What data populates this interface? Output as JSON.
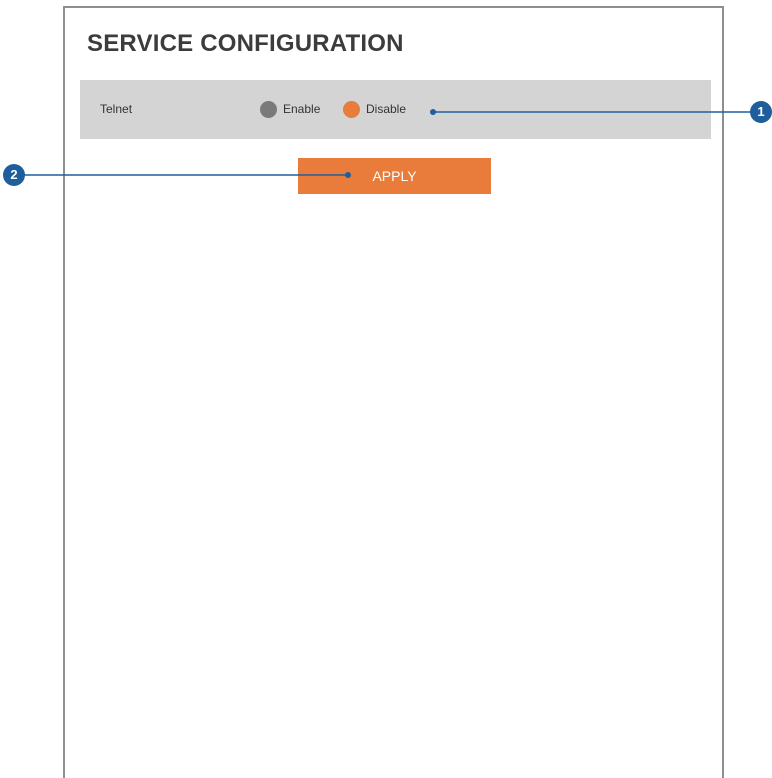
{
  "page": {
    "title": "SERVICE CONFIGURATION"
  },
  "telnet": {
    "label": "Telnet",
    "options": [
      {
        "label": "Enable",
        "selected": false
      },
      {
        "label": "Disable",
        "selected": true
      }
    ],
    "colors": {
      "unselected": "#7a7a7a",
      "selected": "#e97b3b"
    }
  },
  "apply": {
    "label": "APPLY",
    "color": "#e97b3b"
  },
  "callouts": [
    {
      "number": "1"
    },
    {
      "number": "2"
    }
  ],
  "colors": {
    "callout": "#1f5e9c",
    "row_background": "#d4d4d4"
  }
}
